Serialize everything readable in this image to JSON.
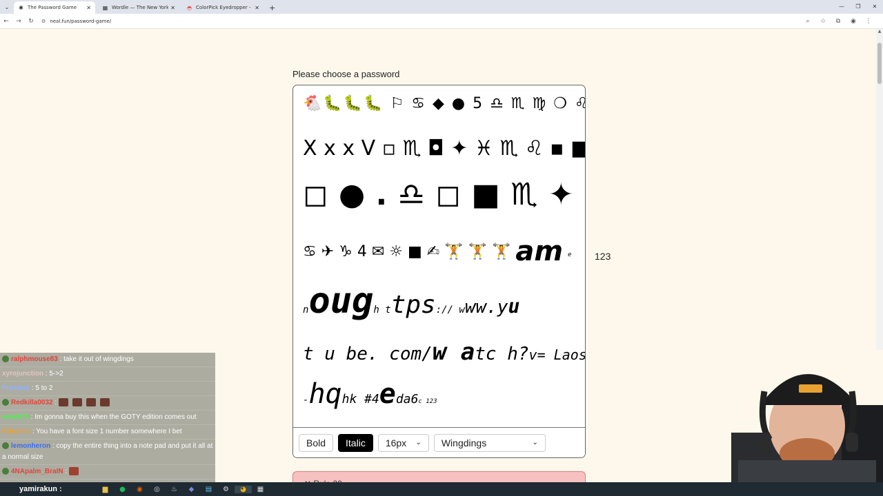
{
  "browser": {
    "tabs": [
      {
        "title": "The Password Game",
        "icon": "star-icon",
        "active": true
      },
      {
        "title": "Wordle — The New York Times",
        "icon": "nyt-icon",
        "active": false
      },
      {
        "title": "ColorPick Eyedropper - Chrome",
        "icon": "rainbow-icon",
        "active": false
      }
    ],
    "url": "neal.fun/password-game/"
  },
  "page": {
    "prompt": "Please choose a password",
    "length_count": "123",
    "password_lines": [
      "🐔🐛🐛🐛 ⚐ ♋ ◆ ● 5 ♎ ♏ ♍ ❍ ♌ ❐",
      "X x x V ▫ ♏ ◘ ✦ ♓ ♏ ♌ ▪ ■ ◆ ▫",
      "◻ ● . ♎ ◻ ■ ♏ ✦ ♓",
      "♋ ✈ ♑ 4 ✉ ☼ ■ ✍ 🏋 🏋 🏋",
      "am",
      "e",
      "n",
      "oug",
      "h t",
      "tps",
      ":// w",
      "ww.y",
      "u",
      "t u be. com/",
      "w a",
      "tc h?",
      "v= Laosh",
      "t",
      "-",
      "hq",
      "hk #4",
      "e",
      "da6",
      "c 123"
    ],
    "toolbar": {
      "bold_label": "Bold",
      "italic_label": "Italic",
      "size_value": "16px",
      "font_value": "Wingdings"
    },
    "rule_partial": "✕ Rule 20"
  },
  "chat": {
    "messages": [
      {
        "user": "ralphmouse83",
        "text": ": take it out of wingdings",
        "color": "#e0443a"
      },
      {
        "user": "xyrojunction",
        "text": ": 5->2",
        "color": "#e3c4c4"
      },
      {
        "user": "Prestery",
        "text": ": 5 to 2",
        "color": "#8fb3ff"
      },
      {
        "user": "Redkilla0032",
        "text": ":",
        "color": "#e0443a"
      },
      {
        "user": "eseck76",
        "text": ": Im gonna buy this when the GOTY edition comes out",
        "color": "#4ef04e"
      },
      {
        "user": "Khromio",
        "text": ": You have a font size 1 number somewhere I bet",
        "color": "#f0a030"
      },
      {
        "user": "lemonheron",
        "text": ": copy the entire thing into a note pad and put it all at a normal size",
        "color": "#3a6ef0"
      },
      {
        "user": "4NApalm_BraIN",
        "text": ":",
        "color": "#e0443a"
      },
      {
        "user": "yamirakun",
        "text": ":",
        "color": "#ffffff"
      }
    ]
  },
  "colors": {
    "page_bg": "#fdf8eb",
    "italic_active": "#000000",
    "rule_error": "#f6c1c0"
  }
}
